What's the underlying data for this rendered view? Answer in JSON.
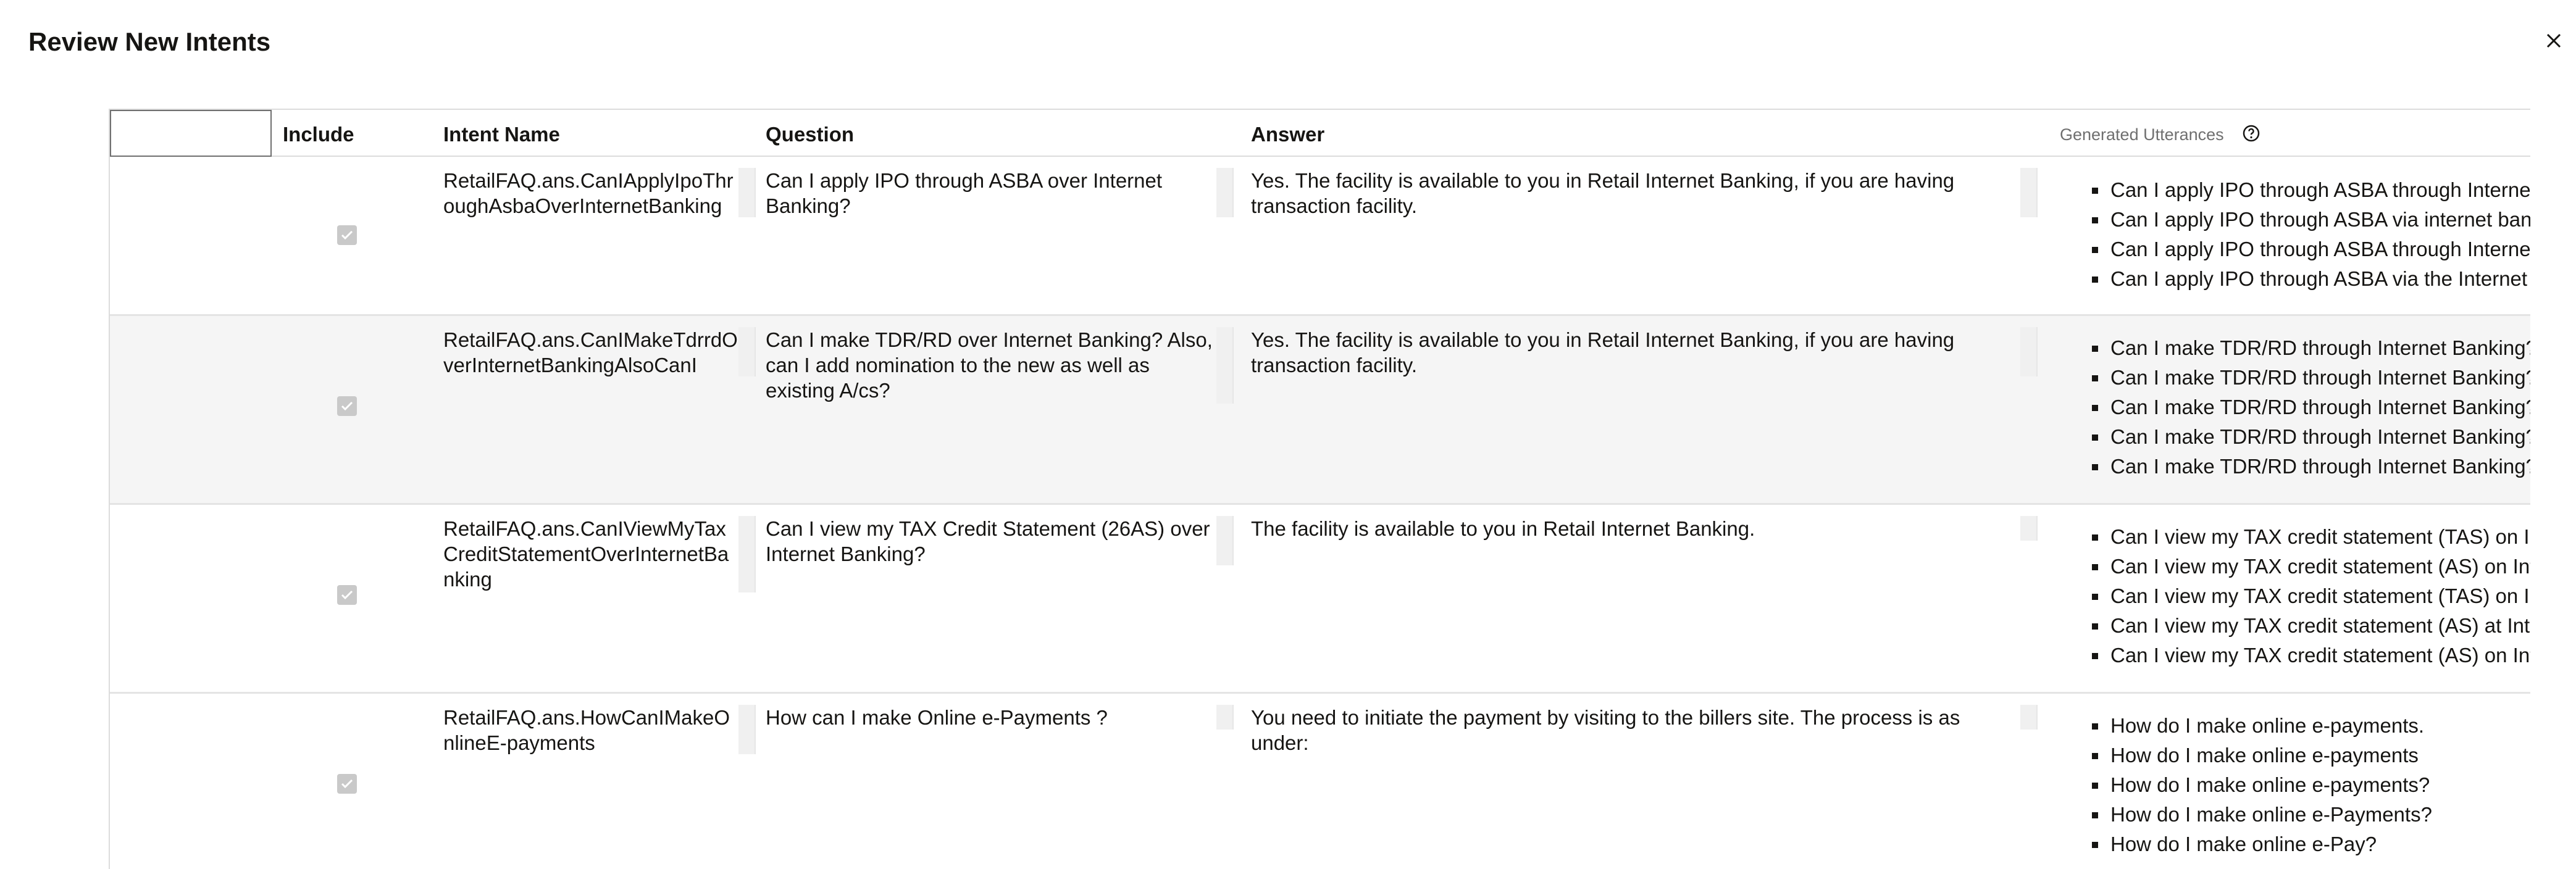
{
  "dialog": {
    "title": "Review New Intents"
  },
  "table": {
    "columns": {
      "include": "Include",
      "intent_name": "Intent Name",
      "question": "Question",
      "answer": "Answer",
      "generated_utterances": "Generated Utterances"
    },
    "rows": [
      {
        "include": true,
        "intent_name": "RetailFAQ.ans.CanIApplyIpoThroughAsbaOverInternetBanking",
        "question": "Can I apply IPO through ASBA over Internet Banking?",
        "answer": "Yes. The facility is available to you in Retail Internet Banking, if you are having transaction facility.",
        "utterances": [
          "Can I apply IPO through ASBA through Internet",
          "Can I apply IPO through ASBA via internet bank",
          "Can I apply IPO through ASBA through Internet",
          "Can I apply IPO through ASBA via the Internet B"
        ]
      },
      {
        "include": true,
        "intent_name": "RetailFAQ.ans.CanIMakeTdrrdOverInternetBankingAlsoCanI",
        "question": "Can I make TDR/RD over Internet Banking? Also, can I add nomination to the new as well as existing A/cs?",
        "answer": "Yes. The facility is available to you in Retail Internet Banking, if you are having transaction facility.",
        "utterances": [
          "Can I make TDR/RD through Internet Banking?",
          "Can I make TDR/RD through Internet Banking?",
          "Can I make TDR/RD through Internet Banking?",
          "Can I make TDR/RD through Internet Banking?",
          "Can I make TDR/RD through Internet Banking?"
        ]
      },
      {
        "include": true,
        "intent_name": "RetailFAQ.ans.CanIViewMyTaxCreditStatementOverInternetBanking",
        "question": "Can I view my TAX Credit Statement (26AS) over Internet Banking?",
        "answer": "The facility is available to you in Retail Internet Banking.",
        "utterances": [
          "Can I view my TAX credit statement (TAS) on Int",
          "Can I view my TAX credit statement (AS) on Inte",
          "Can I view my TAX credit statement (TAS) on Int",
          "Can I view my TAX credit statement (AS) at Inter",
          "Can I view my TAX credit statement (AS) on Inte"
        ]
      },
      {
        "include": true,
        "intent_name": "RetailFAQ.ans.HowCanIMakeOnlineE-payments",
        "question": "How can I make Online e-Payments ?",
        "answer": "You need to initiate the payment by visiting to the billers site. The process is as under:",
        "utterances": [
          "How do I make online e-payments.",
          "How do I make online e-payments",
          "How do I make online e-payments?",
          "How do I make online e-Payments?",
          "How do I make online e-Pay?"
        ]
      }
    ]
  }
}
